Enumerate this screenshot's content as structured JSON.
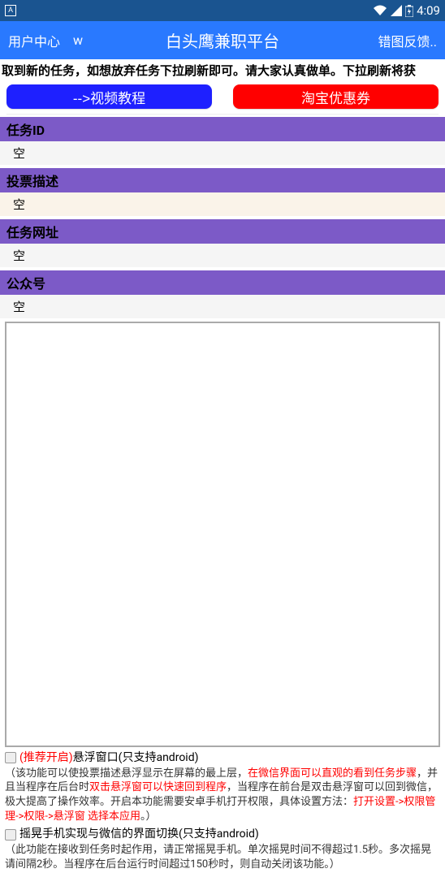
{
  "status_bar": {
    "app_indicator": "A",
    "time": "4:09"
  },
  "app_bar": {
    "left1": "用户中心",
    "left2": "w",
    "title": "白头鹰兼职平台",
    "right": "错图反馈.."
  },
  "notice": "取到新的任务，如想放弃任务下拉刷新即可。请大家认真做单。下拉刷新将获",
  "buttons": {
    "video": "-->视频教程",
    "coupon": "淘宝优惠券"
  },
  "sections": {
    "task_id": {
      "label": "任务ID",
      "value": "空"
    },
    "vote_desc": {
      "label": "投票描述",
      "value": "空"
    },
    "task_url": {
      "label": "任务网址",
      "value": "空"
    },
    "gzh": {
      "label": "公众号",
      "value": "空"
    }
  },
  "option1": {
    "recommend": "(推荐开启)",
    "title_rest": "悬浮窗口(只支持android)",
    "desc_a": "（该功能可以使投票描述悬浮显示在屏幕的最上层，",
    "desc_b_red": "在微信界面可以直观的看到任务步骤",
    "desc_c": "，并且当程序在后台时",
    "desc_d_red": "双击悬浮窗可以快速回到程序",
    "desc_e": "，当程序在前台是双击悬浮窗可以回到微信，极大提高了操作效率。开启本功能需要安卓手机打开权限，具体设置方法：",
    "desc_f_red": "打开设置->权限管理->权限->悬浮窗 选择本应用",
    "desc_g": "。）"
  },
  "option2": {
    "title": "摇晃手机实现与微信的界面切换(只支持android)",
    "desc": "（此功能在接收到任务时起作用，请正常摇晃手机。单次摇晃时间不得超过1.5秒。多次摇晃请间隔2秒。当程序在后台运行时间超过150秒时，则自动关闭该功能。）"
  }
}
